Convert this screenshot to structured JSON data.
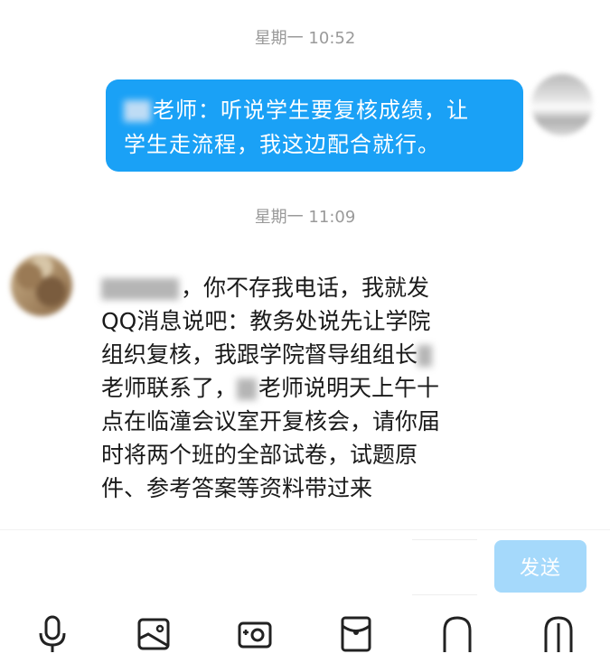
{
  "chat": {
    "timestamp_1": "星期一 10:52",
    "timestamp_2": "星期一 11:09",
    "outgoing_message": "老师：听说学生要复核成绩，让学生走流程，我这边配合就行。",
    "outgoing_line_1": "老师：听说学生要复核成绩，让",
    "outgoing_line_2": "学生走流程，我这边配合就行。",
    "incoming_lines": [
      "，你不存我电话，我就发",
      "QQ消息说吧：教务处说先让学院",
      "组织复核，我跟学院督导组组长",
      "老师联系了，",
      "老师说明天上午十",
      "点在临潼会议室开复核会，请你届",
      "时将两个班的全部试卷，试题原",
      "件、参考答案等资料带过来"
    ]
  },
  "composer": {
    "send_label": "发送"
  },
  "toolbar": {
    "icons": [
      "microphone-icon",
      "image-icon",
      "camera-icon",
      "red-packet-icon",
      "arch-icon",
      "arch-icon"
    ]
  },
  "colors": {
    "outgoing_bubble": "#1aa1f6",
    "send_button": "#a5d9fb",
    "timestamp_text": "#9a9a9a"
  }
}
